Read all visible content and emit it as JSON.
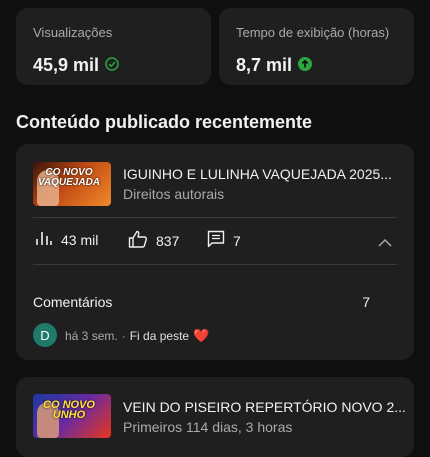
{
  "stats": [
    {
      "label": "Visualizações",
      "value": "45,9 mil",
      "icon": "check-circle-icon",
      "icon_color": "#2ba640"
    },
    {
      "label": "Tempo de exibição (horas)",
      "value": "8,7 mil",
      "icon": "arrow-up-circle-icon",
      "icon_color": "#2ba640"
    }
  ],
  "section_title": "Conteúdo publicado recentemente",
  "videos": [
    {
      "thumb_text": "CO NOVO VAQUEJADA",
      "title": "IGUINHO E LULINHA VAQUEJADA 2025...",
      "subtitle": "Direitos autorais",
      "views": "43 mil",
      "likes": "837",
      "comments": "7",
      "comments_label": "Comentários",
      "comments_count": "7",
      "latest_comment": {
        "avatar_letter": "D",
        "time": "há 3 sem.",
        "separator": "·",
        "text": "Fi da peste"
      }
    },
    {
      "thumb_text": "CO NOVO UNHO",
      "title": "VEIN DO PISEIRO REPERTÓRIO NOVO 2...",
      "subtitle": "Primeiros 114 dias, 3 horas"
    }
  ],
  "colors": {
    "background": "#0f0f0f",
    "card": "#1f1f1f",
    "accent_green": "#2ba640",
    "heart": "#e4222a"
  }
}
